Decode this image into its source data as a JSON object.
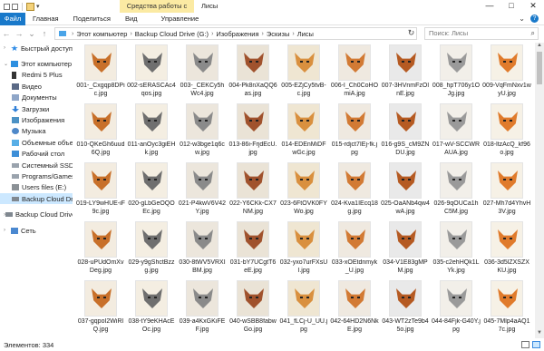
{
  "title": {
    "context_tab": "Средства работы с рисунками",
    "window_name": "Лисы",
    "minimize": "—",
    "maximize": "□",
    "close": "✕"
  },
  "ribbon": {
    "file": "Файл",
    "tabs": [
      "Главная",
      "Поделиться",
      "Вид"
    ],
    "manage": "Управление",
    "chevron": "⌄",
    "help": "?"
  },
  "address": {
    "back": "←",
    "forward": "→",
    "up": "↑",
    "history": "⌄",
    "crumbs": [
      "Этот компьютер",
      "Backup Cloud Drive (G:)",
      "Изображения",
      "Эскизы",
      "Лисы"
    ],
    "refresh": "↻",
    "search_placeholder": "Поиск: Лисы",
    "search_icon": "search-icon"
  },
  "nav": {
    "items": [
      {
        "label": "Быстрый доступ",
        "icon": "star-icon"
      },
      {
        "label": "Этот компьютер",
        "icon": "pc-icon"
      },
      {
        "label": "Redmi 5 Plus",
        "icon": "phone-icon"
      },
      {
        "label": "Видео",
        "icon": "video-icon"
      },
      {
        "label": "Документы",
        "icon": "document-icon"
      },
      {
        "label": "Загрузки",
        "icon": "download-icon"
      },
      {
        "label": "Изображения",
        "icon": "pictures-icon"
      },
      {
        "label": "Музыка",
        "icon": "music-icon"
      },
      {
        "label": "Объемные объект",
        "icon": "objects-icon"
      },
      {
        "label": "Рабочий стол",
        "icon": "desktop-icon"
      },
      {
        "label": "Системный SSD (C:)",
        "icon": "drive-icon"
      },
      {
        "label": "Programs/Games (D",
        "icon": "drive-icon"
      },
      {
        "label": "Users files (E:)",
        "icon": "user-drive-icon"
      },
      {
        "label": "Backup Cloud Drive",
        "icon": "cloud-drive-icon"
      },
      {
        "label": "Backup Cloud Drive (",
        "icon": "cloud-drive-icon"
      },
      {
        "label": "Сеть",
        "icon": "network-icon"
      }
    ]
  },
  "files": [
    "001-_Cxgqp8DPic.jpg",
    "002-sERASCAc4qos.jpg",
    "003-_CEKCy5hWc4.jpg",
    "004-Pk8nXaQQ6as.jpg",
    "005-EZjCy5tvB-c.jpg",
    "006-I_Ch0CoHOmiA.jpg",
    "007-3HVnmFzOInE.jpg",
    "008_hpT706y1OJg.jpg",
    "009-VqFmNxv1wyU.jpg",
    "010-QKeGh6uud6Q.jpg",
    "011-anOyc3giEHk.jpg",
    "012-w3bge1q6cw.jpg",
    "013-86i-FrjdEcU.jpg",
    "014-EDEnMiDFwGc.jpg",
    "015-rdjct7IEj-fk.jpg",
    "016-g9S_cM9ZNDU.jpg",
    "017-wV-SCCWRAUA.jpg",
    "018-ltzAcQ_kf96o.jpg",
    "019-LY9wHUE-iF9c.jpg",
    "020-gLbGeOQOEc.jpg",
    "021-P4kwV6V42Y.jpg",
    "022-Y6CKk-CX7NM.jpg",
    "023-6FtOVK0FYWo.jpg",
    "024-Kva1IEcq18g.jpg",
    "025-OaANb4qw4wA.jpg",
    "026-9qOUCa1hC5M.jpg",
    "027-Mh7d4YhvH3V.jpg",
    "028-uPUdOmXvDeg.jpg",
    "029-y9gShctBzzg.jpg",
    "030-8tWV5VRXIBM.jpg",
    "031-bY7UCgtT6eE.jpg",
    "032-yxo7urFXsUI.jpg",
    "033-xOEtdnmyk_U.jpg",
    "034-V1E83gMPM.jpg",
    "035-c2ehHQk1LYk.jpg",
    "036-3d5lZXSZXKU.jpg",
    "037-gqpoI2WiRlQ.jpg",
    "038-tY9eKHAcEOc.jpg",
    "039-a4KxGKiFEF.jpg",
    "040-wSBB8fabwGo.jpg",
    "041_fLCj-U_UU.jpg",
    "042-64HD2N6NkE.jpg",
    "043-WT2zTe9b45o.jpg",
    "044-84Fjk-G40Y.jpg",
    "045-7Mlp4aAQ17c.jpg"
  ],
  "status": {
    "count": "Элементов: 334"
  },
  "palette": {
    "accent": "#1979ca",
    "selection": "#cce8ff",
    "context_tab": "#fbeaa3"
  }
}
